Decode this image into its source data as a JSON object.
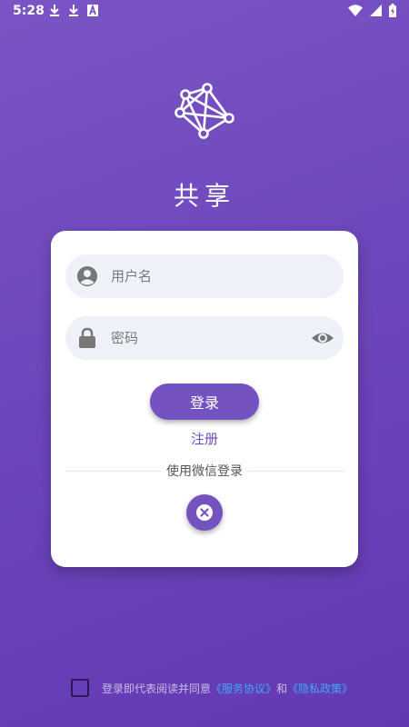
{
  "status_bar": {
    "time": "5:28",
    "left_icons": [
      "download-icon",
      "download-icon",
      "font-icon"
    ],
    "right_icons": [
      "wifi-icon",
      "signal-icon",
      "battery-icon"
    ]
  },
  "app": {
    "title": "共享",
    "logo_icon": "network-logo-icon"
  },
  "login_form": {
    "username_placeholder": "用户名",
    "password_placeholder": "密码",
    "login_label": "登录",
    "register_label": "注册",
    "wechat_divider_label": "使用微信登录"
  },
  "agreement": {
    "prefix": "登录即代表阅读并同意",
    "service_link": "《服务协议》",
    "and": "和",
    "privacy_link": "《隐私政策》"
  },
  "colors": {
    "background_top": "#7b54c4",
    "background_bottom": "#6339b3",
    "accent": "#7452c0",
    "link": "#3fa9f5",
    "field_bg": "#eef2f8"
  }
}
